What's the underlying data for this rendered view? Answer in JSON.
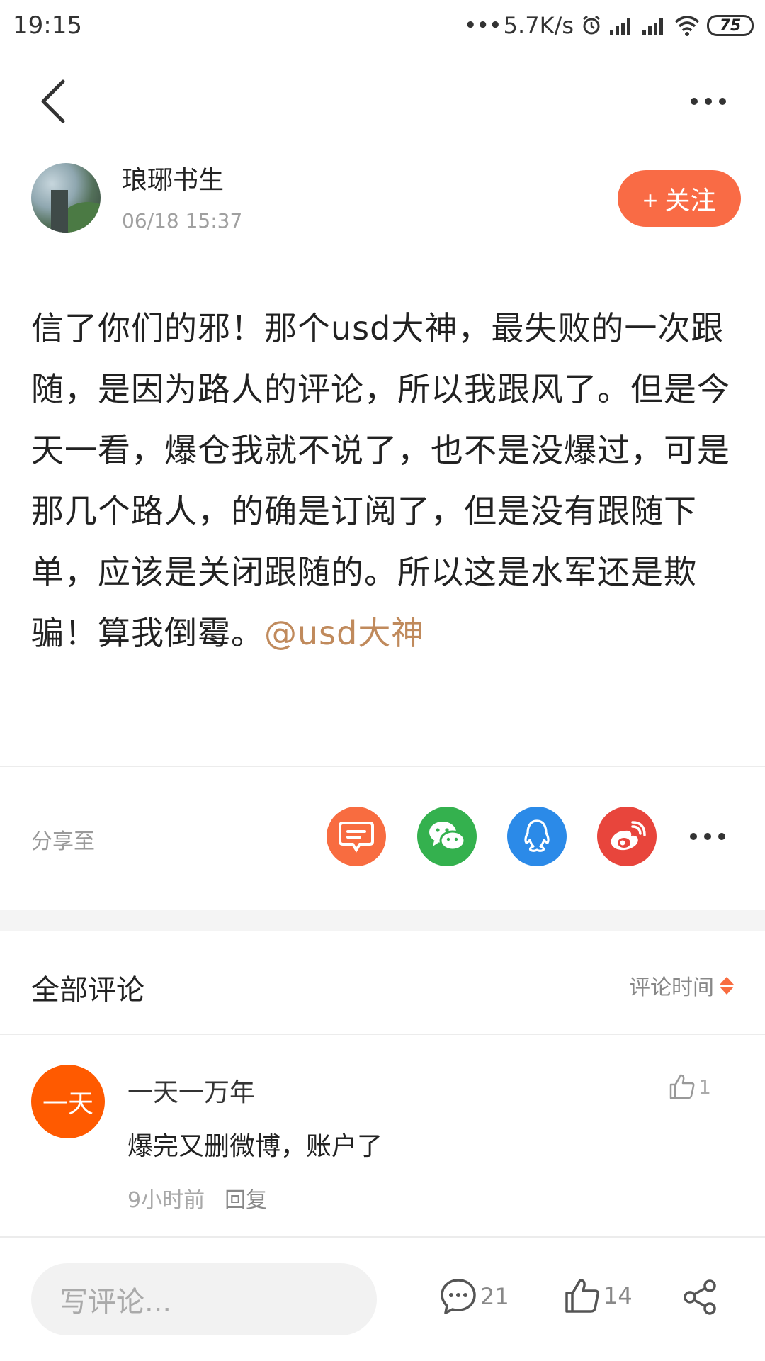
{
  "status_bar": {
    "time": "19:15",
    "net_speed": "5.7K/s",
    "battery": "75"
  },
  "nav": {
    "back_icon": "chevron-left-icon",
    "more_icon": "more-horizontal-icon"
  },
  "author": {
    "name": "琅琊书生",
    "time": "06/18 15:37",
    "follow_label": "+ 关注"
  },
  "post": {
    "text": "信了你们的邪！那个usd大神，最失败的一次跟随，是因为路人的评论，所以我跟风了。但是今天一看，爆仓我就不说了，也不是没爆过，可是那几个路人，的确是订阅了，但是没有跟随下单，应该是关闭跟随的。所以这是水军还是欺骗！算我倒霉。",
    "mention": "@usd大神"
  },
  "share": {
    "label": "分享至",
    "targets": [
      "message-icon",
      "wechat-icon",
      "qq-icon",
      "weibo-icon",
      "more-horizontal-icon"
    ]
  },
  "comments": {
    "title": "全部评论",
    "sort_label": "评论时间",
    "items": [
      {
        "avatar_text": "一天",
        "name": "一天一万年",
        "text": "爆完又删微博，账户了",
        "time": "9小时前",
        "reply_label": "回复",
        "likes": "1"
      }
    ]
  },
  "bottom_bar": {
    "input_placeholder": "写评论...",
    "comment_count": "21",
    "like_count": "14"
  },
  "colors": {
    "accent": "#f96b45",
    "mention": "#c08a5c",
    "wechat": "#34b14e",
    "qq": "#2b8ae8",
    "weibo": "#e8453c",
    "comment_avatar": "#ff5a00"
  }
}
